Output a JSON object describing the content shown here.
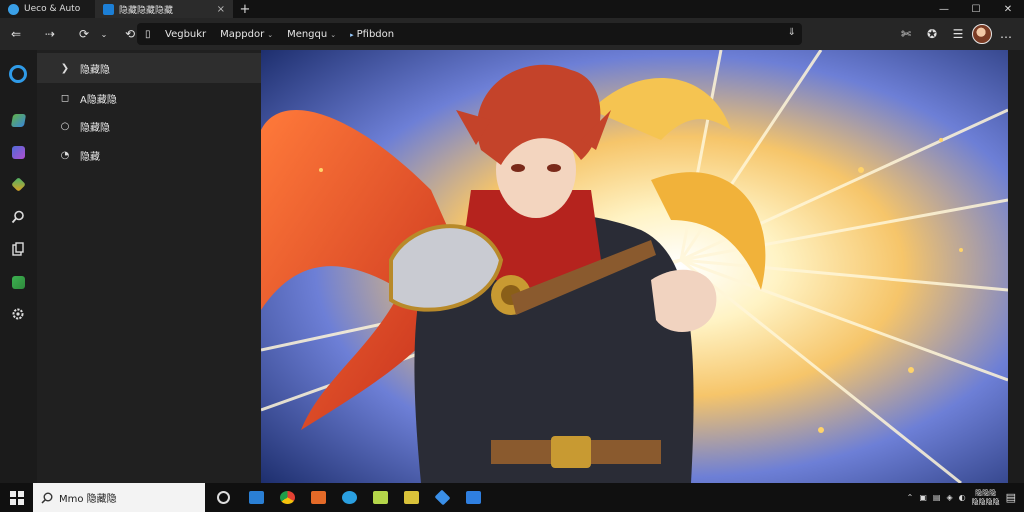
{
  "tabs": [
    {
      "title": "Ueco & Auto",
      "favicon_color": "#3aa0e8",
      "active": false
    },
    {
      "title": "隐藏隐藏隐藏",
      "favicon_color": "#1c7fd6",
      "active": true
    }
  ],
  "tabbar": {
    "new_tab": "+",
    "close": "×",
    "minimize": "—",
    "maximize": "☐",
    "close_window": "✕"
  },
  "toolbar": {
    "back": "⇐",
    "forward": "⇢",
    "refresh": "⟳",
    "refresh_dd": "⌄",
    "home": "⟲",
    "address_segments": [
      "Vegbukr",
      "Mappdor",
      "Mengqu",
      "Pfibdon"
    ],
    "address_dd": "⌄",
    "address_down": "⇓",
    "right_icons": [
      "✄",
      "✪",
      "☰",
      "…"
    ]
  },
  "rail": {
    "icons": [
      {
        "name": "cortana-icon",
        "color": "#2f9be8"
      },
      {
        "name": "brush-icon",
        "color": "#5fb04a"
      },
      {
        "name": "document-icon",
        "color": "#4f6bd8"
      },
      {
        "name": "tools-icon",
        "color": "#46b36b"
      },
      {
        "name": "search-icon",
        "color": "#dddddd"
      },
      {
        "name": "files-icon",
        "color": "#dddddd"
      },
      {
        "name": "image-icon",
        "color": "#3cb050"
      },
      {
        "name": "settings-icon",
        "color": "#dddddd"
      }
    ]
  },
  "panel": {
    "items": [
      {
        "icon": "❯",
        "label": "隐藏隐",
        "selected": true
      },
      {
        "icon": "◻",
        "label": "A隐藏隐",
        "selected": false
      },
      {
        "icon": "○",
        "label": "隐藏隐",
        "selected": false
      },
      {
        "icon": "◔",
        "label": "隐藏",
        "selected": false
      }
    ]
  },
  "taskbar": {
    "search_text": "Mmo 隐藏隐",
    "apps": [
      "#2a7fd4",
      "#e8a21c",
      "#e46a28",
      "#2a9fe0",
      "#b4d64a",
      "#d9c23a",
      "#3a8fe8",
      "#2f7fe0"
    ],
    "tray_icons": [
      "⌃",
      "▣",
      "▤",
      "◈",
      "◐"
    ],
    "clock_line1": "隐隐隐",
    "clock_line2": "隐隐隐隐",
    "notify_icon": "▤"
  }
}
